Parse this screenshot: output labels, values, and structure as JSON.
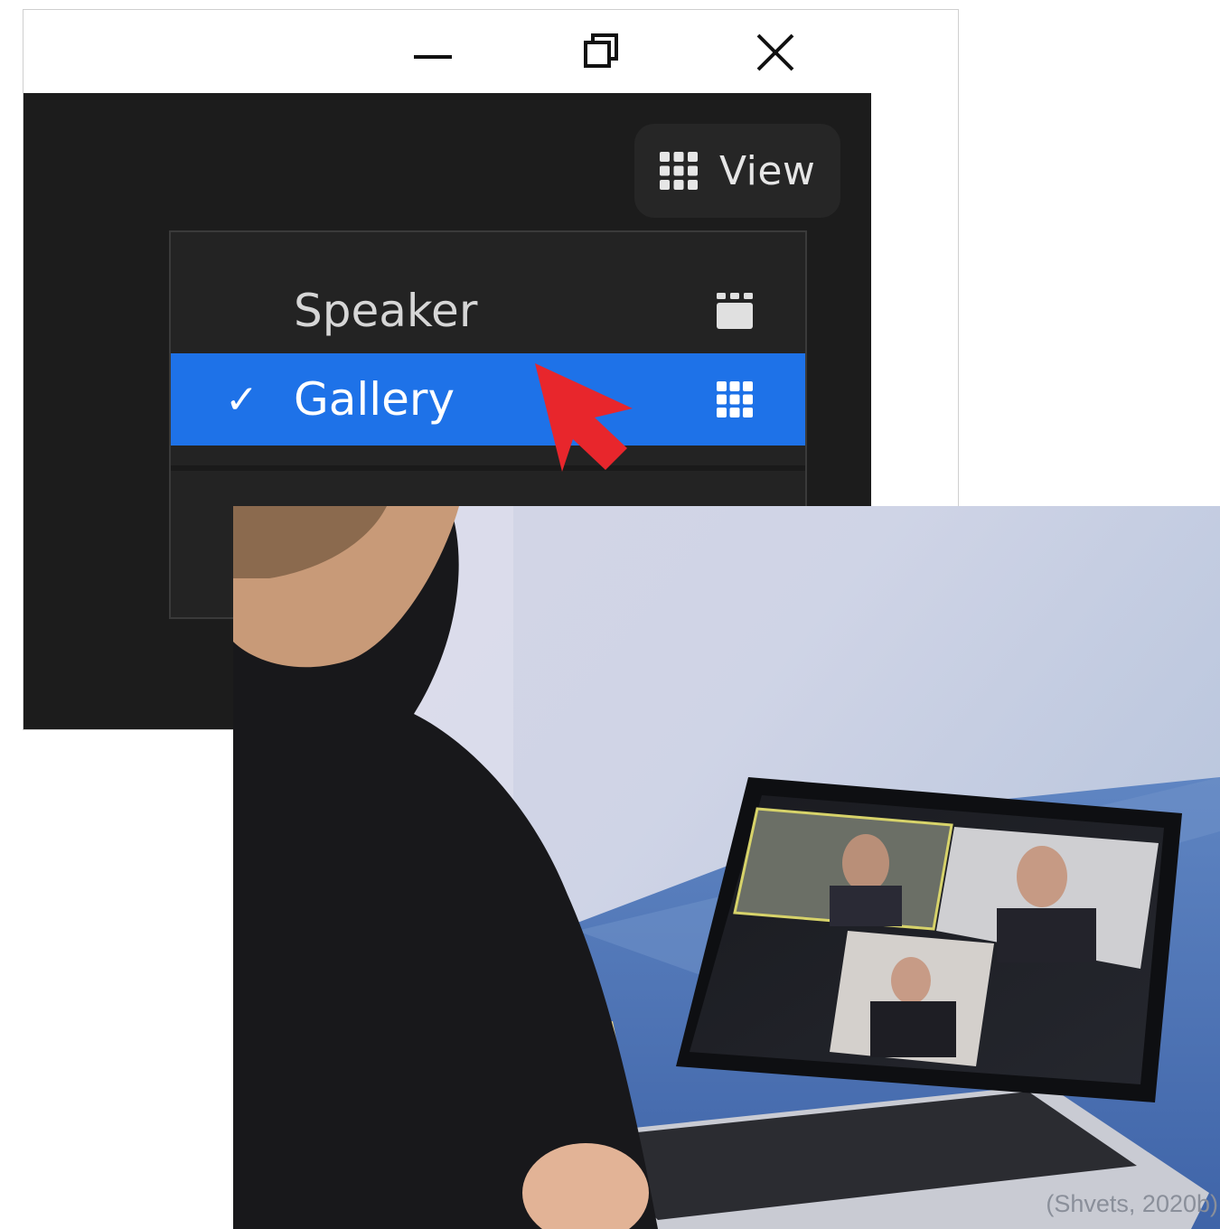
{
  "window": {
    "controls": {
      "minimize_icon": "minimize-icon",
      "maximize_icon": "restore-icon",
      "close_icon": "close-icon"
    },
    "view_button": {
      "label": "View",
      "icon": "grid-icon"
    },
    "view_menu": {
      "items": [
        {
          "label": "Speaker",
          "checked": false,
          "icon": "speaker-view-icon"
        },
        {
          "label": "Gallery",
          "checked": true,
          "check_mark": "✓",
          "icon": "gallery-grid-icon"
        }
      ],
      "selected_color": "#1e72e8"
    },
    "pointer_icon": "red-arrow-pointer-icon",
    "pointer_color": "#e8262c"
  },
  "photo": {
    "description_icon": "video-call-photo",
    "credit": "(Shvets, 2020b)"
  }
}
